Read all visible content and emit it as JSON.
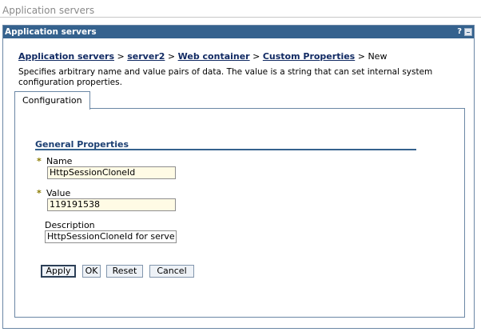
{
  "page_title": "Application servers",
  "portlet": {
    "title": "Application servers",
    "help_label": "?",
    "minimize_label": "-"
  },
  "breadcrumb": {
    "items": [
      "Application servers",
      "server2",
      "Web container",
      "Custom Properties"
    ],
    "separator": ">",
    "current": "New"
  },
  "description": "Specifies arbitrary name and value pairs of data. The value is a string that can set internal system configuration properties.",
  "tabs": [
    {
      "label": "Configuration",
      "selected": true
    }
  ],
  "general_properties": {
    "title": "General Properties",
    "required_marker": "*",
    "fields": {
      "name": {
        "label": "Name",
        "value": "HttpSessionCloneId",
        "required": true
      },
      "value": {
        "label": "Value",
        "value": "119191538",
        "required": true
      },
      "description": {
        "label": "Description",
        "value": "HttpSessionCloneId for serve",
        "required": false
      }
    }
  },
  "buttons": {
    "apply": "Apply",
    "ok": "OK",
    "reset": "Reset",
    "cancel": "Cancel"
  },
  "colors": {
    "title_bar": "#35628e",
    "required_input_bg": "#fffbe5",
    "link": "#112a63"
  }
}
